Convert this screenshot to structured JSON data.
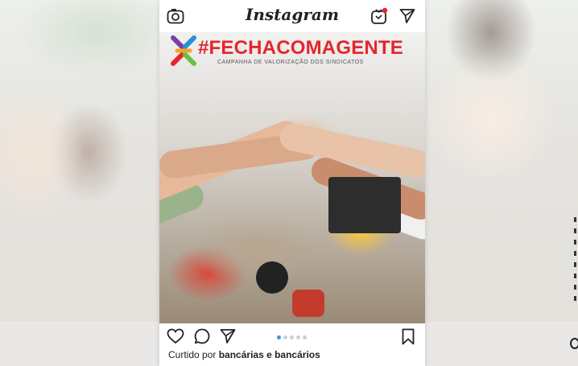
{
  "app": {
    "title": "Instagram"
  },
  "banner": {
    "title": "#FECHACOMAGENTE",
    "subtitle": "CAMPANHA DE VALORIZAÇÃO DOS SINDICATOS"
  },
  "post": {
    "carousel": {
      "count": 5,
      "active_index": 0
    },
    "likes_prefix": "Curtido por",
    "likes_names": "bancárias e bancários"
  },
  "icons": {
    "camera": "camera-icon",
    "igtv": "igtv-icon",
    "direct": "paper-plane-icon",
    "like": "heart-icon",
    "comment": "comment-icon",
    "share": "paper-plane-icon",
    "save": "bookmark-icon"
  },
  "colors": {
    "brand_red": "#e5262b",
    "carousel_active": "#3897f0",
    "notification_dot": "#e5262b"
  }
}
